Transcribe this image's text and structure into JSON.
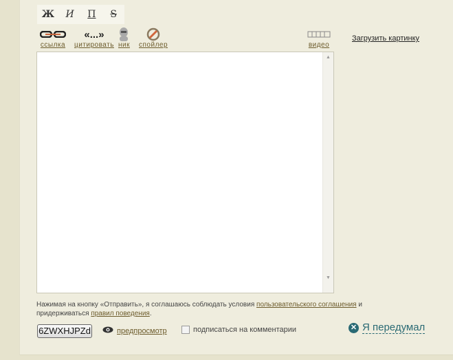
{
  "format": {
    "bold": "Ж",
    "italic": "И",
    "underline": "П",
    "strike": "S"
  },
  "tools": {
    "link": "ссылка",
    "quote": "цитировать",
    "quote_glyph": "«...»",
    "nick": "ник",
    "spoiler": "спойлер",
    "video": "видео"
  },
  "upload_label": "Загрузить картинку",
  "editor": {
    "value": ""
  },
  "agreement": {
    "text1": "Нажимая на кнопку «Отправить», я соглашаюсь соблюдать условия ",
    "link1": "пользовательского соглашения",
    "text2": " и придерживаться ",
    "link2": "правил поведения",
    "text3": "."
  },
  "submit_label": "6ZWXHJPZd",
  "preview_label": "предпросмотр",
  "subscribe_label": "подписаться на комментарии",
  "cancel_label": "Я передумал"
}
